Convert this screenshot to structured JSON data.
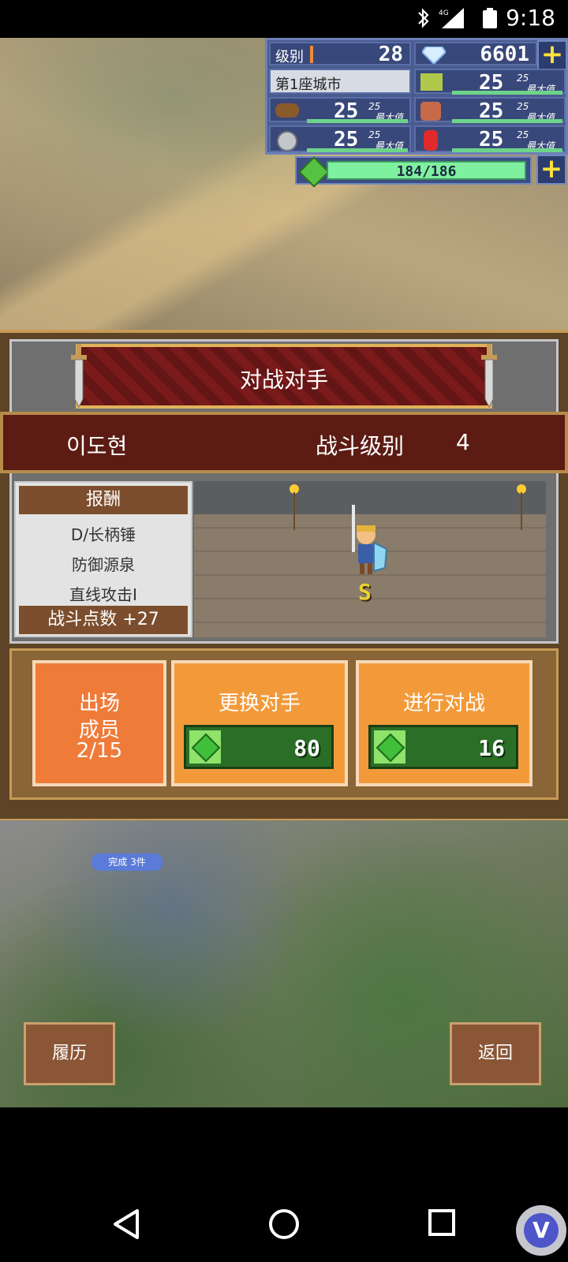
{
  "status_bar": {
    "time": "9:18",
    "network": "4G"
  },
  "hud": {
    "level_label": "级别",
    "level_value": "28",
    "diamond_value": "6601",
    "city_label": "第1座城市",
    "resources": [
      {
        "icon": "grass-icon",
        "current": "25",
        "max": "25",
        "max_label": "最大值",
        "fill": 1.0
      },
      {
        "icon": "wood-icon",
        "current": "25",
        "max": "25",
        "max_label": "最大值",
        "fill": 1.0
      },
      {
        "icon": "food-icon",
        "current": "25",
        "max": "25",
        "max_label": "最大值",
        "fill": 1.0
      },
      {
        "icon": "ore-icon",
        "current": "25",
        "max": "25",
        "max_label": "最大值",
        "fill": 1.0
      },
      {
        "icon": "ruby-icon",
        "current": "25",
        "max": "25",
        "max_label": "最大值",
        "fill": 1.0
      }
    ],
    "stamina_text": "184/186",
    "stamina_fraction": 0.989
  },
  "dialog": {
    "title": "对战对手",
    "opponent_name": "이도현",
    "battle_level_label": "战斗级别",
    "battle_level_value": "4",
    "reward_header": "报酬",
    "rewards": [
      "D/长柄锤",
      "防御源泉",
      "直线攻击I"
    ],
    "battle_points": "战斗点数 +27",
    "rank_letter": "S"
  },
  "buttons": {
    "members_line1": "出场",
    "members_line2": "成员",
    "members_count": "2/15",
    "swap_label": "更换对手",
    "swap_cost": "80",
    "fight_label": "进行对战",
    "fight_cost": "16"
  },
  "background": {
    "bubble_text": "完成 3件"
  },
  "bottom": {
    "history_label": "履历",
    "back_label": "返回"
  },
  "colors": {
    "panel_brown": "#5e4426",
    "banner_red": "#7a1a1a",
    "button_orange": "#f29a3a",
    "gem_green": "#57c241",
    "hud_blue": "#4a5b8e"
  }
}
